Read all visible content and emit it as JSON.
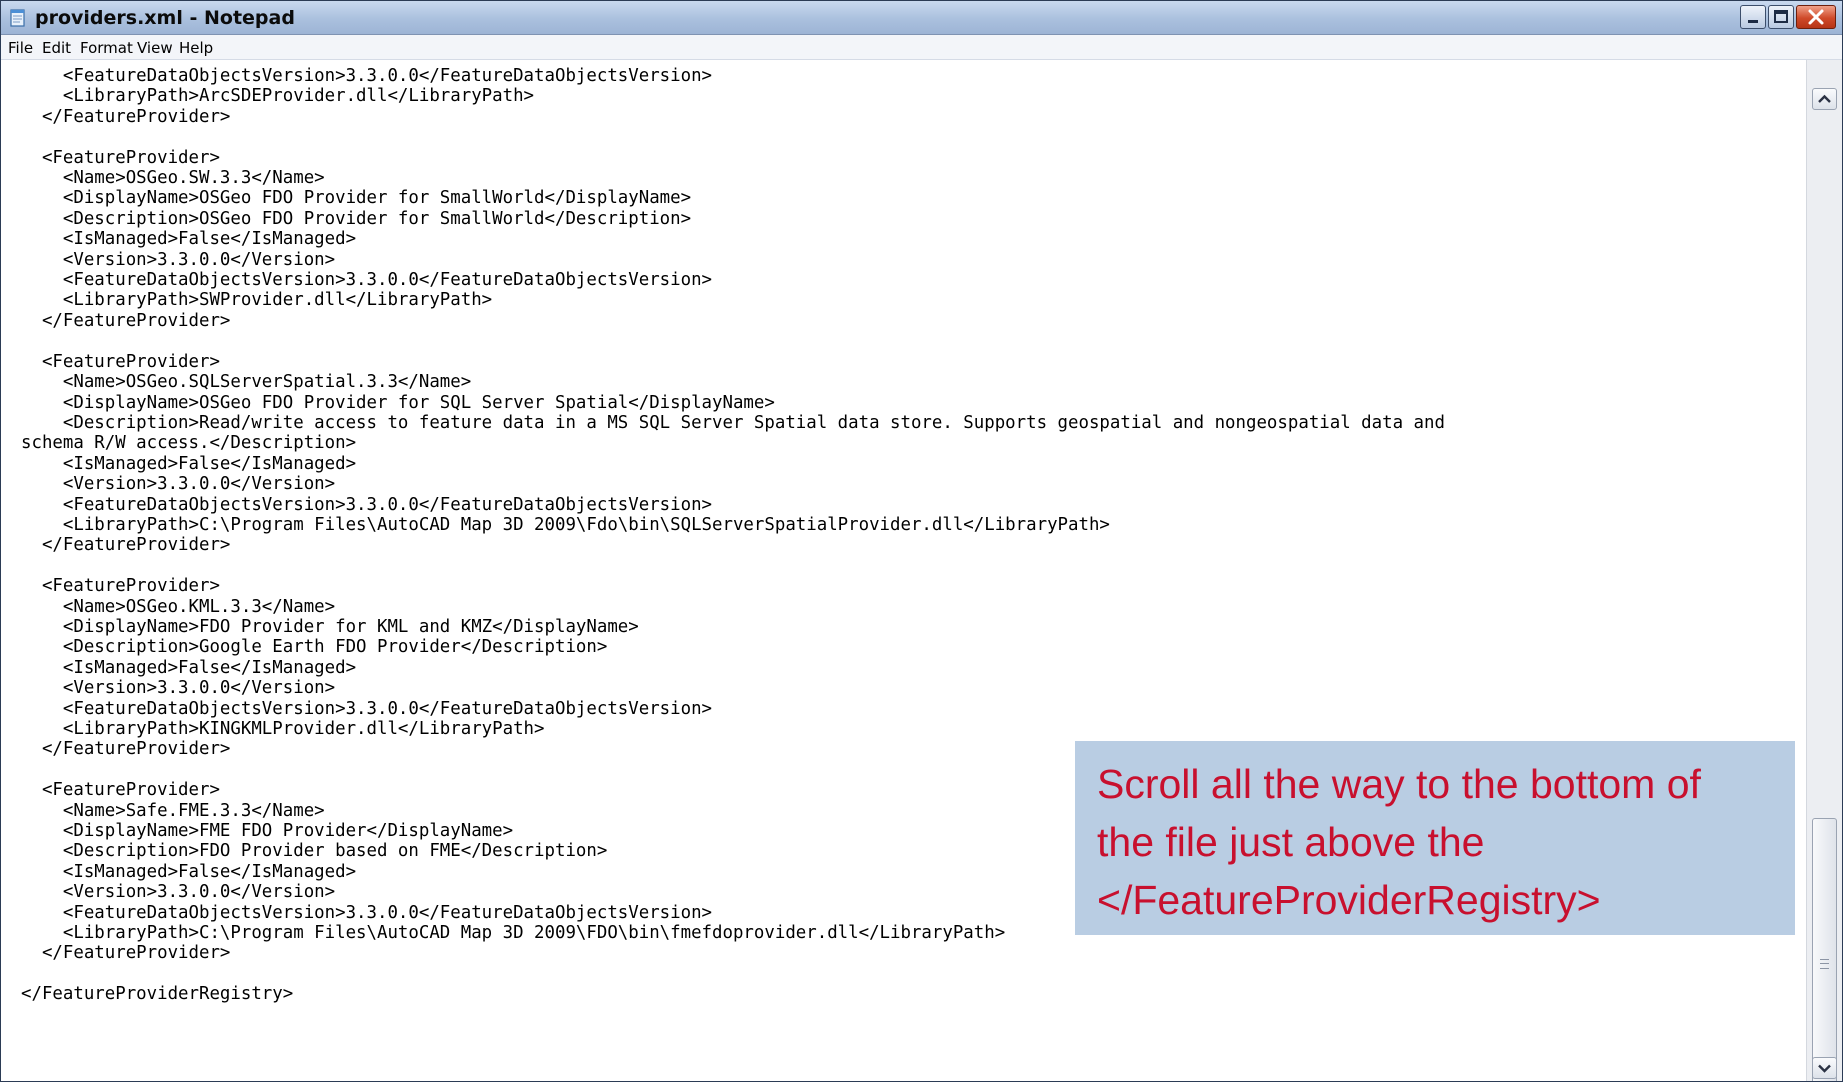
{
  "window": {
    "title": "providers.xml - Notepad",
    "icon": "notepad-icon",
    "controls": [
      "minimize-icon",
      "maximize-icon",
      "close-icon"
    ]
  },
  "menu": [
    "File",
    "Edit",
    "Format",
    "View",
    "Help"
  ],
  "editor": {
    "lines": [
      "    <FeatureDataObjectsVersion>3.3.0.0</FeatureDataObjectsVersion>",
      "    <LibraryPath>ArcSDEProvider.dll</LibraryPath>",
      "  </FeatureProvider>",
      "",
      "  <FeatureProvider>",
      "    <Name>OSGeo.SW.3.3</Name>",
      "    <DisplayName>OSGeo FDO Provider for SmallWorld</DisplayName>",
      "    <Description>OSGeo FDO Provider for SmallWorld</Description>",
      "    <IsManaged>False</IsManaged>",
      "    <Version>3.3.0.0</Version>",
      "    <FeatureDataObjectsVersion>3.3.0.0</FeatureDataObjectsVersion>",
      "    <LibraryPath>SWProvider.dll</LibraryPath>",
      "  </FeatureProvider>",
      "",
      "  <FeatureProvider>",
      "    <Name>OSGeo.SQLServerSpatial.3.3</Name>",
      "    <DisplayName>OSGeo FDO Provider for SQL Server Spatial</DisplayName>",
      "    <Description>Read/write access to feature data in a MS SQL Server Spatial data store. Supports geospatial and nongeospatial data and",
      "schema R/W access.</Description>",
      "    <IsManaged>False</IsManaged>",
      "    <Version>3.3.0.0</Version>",
      "    <FeatureDataObjectsVersion>3.3.0.0</FeatureDataObjectsVersion>",
      "    <LibraryPath>C:\\Program Files\\AutoCAD Map 3D 2009\\Fdo\\bin\\SQLServerSpatialProvider.dll</LibraryPath>",
      "  </FeatureProvider>",
      "",
      "  <FeatureProvider>",
      "    <Name>OSGeo.KML.3.3</Name>",
      "    <DisplayName>FDO Provider for KML and KMZ</DisplayName>",
      "    <Description>Google Earth FDO Provider</Description>",
      "    <IsManaged>False</IsManaged>",
      "    <Version>3.3.0.0</Version>",
      "    <FeatureDataObjectsVersion>3.3.0.0</FeatureDataObjectsVersion>",
      "    <LibraryPath>KINGKMLProvider.dll</LibraryPath>",
      "  </FeatureProvider>",
      "",
      "  <FeatureProvider>",
      "    <Name>Safe.FME.3.3</Name>",
      "    <DisplayName>FME FDO Provider</DisplayName>",
      "    <Description>FDO Provider based on FME</Description>",
      "    <IsManaged>False</IsManaged>",
      "    <Version>3.3.0.0</Version>",
      "    <FeatureDataObjectsVersion>3.3.0.0</FeatureDataObjectsVersion>",
      "    <LibraryPath>C:\\Program Files\\AutoCAD Map 3D 2009\\FDO\\bin\\fmefdoprovider.dll</LibraryPath>",
      "  </FeatureProvider>",
      "",
      "</FeatureProviderRegistry>"
    ]
  },
  "callout": {
    "text": "Scroll all the way to the bottom of\nthe file just above the\n</FeatureProviderRegistry>"
  },
  "scrollbar": {
    "up_icon": "chevron-up-icon",
    "down_icon": "chevron-down-icon"
  }
}
